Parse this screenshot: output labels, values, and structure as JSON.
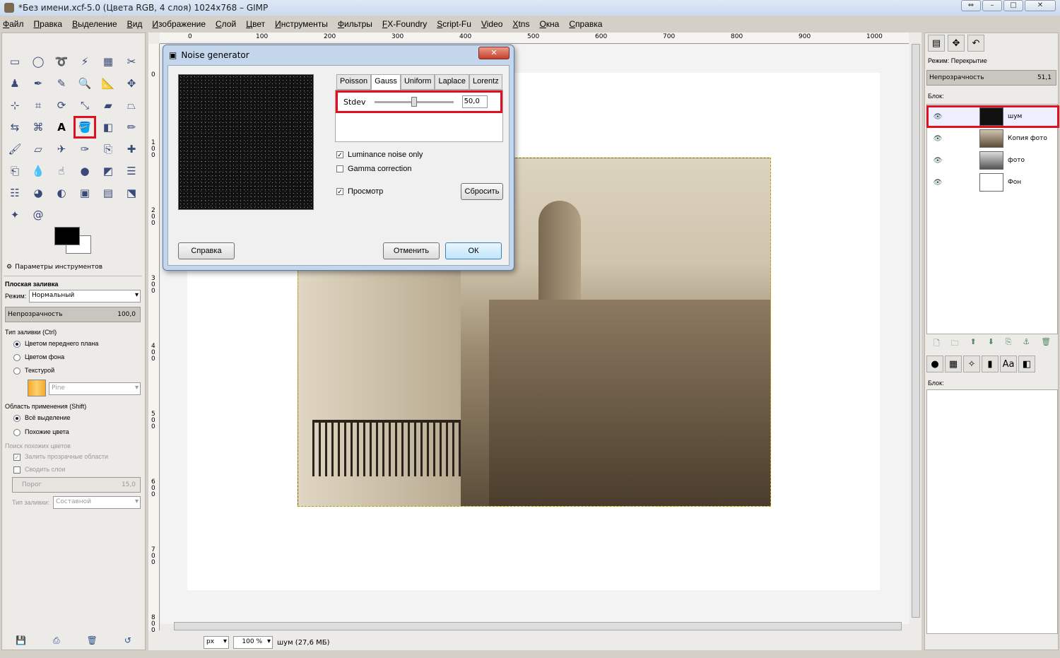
{
  "window": {
    "title": "*Без имени.xcf-5.0 (Цвета RGB, 4 слоя) 1024x768 – GIMP"
  },
  "menu": [
    "Файл",
    "Правка",
    "Выделение",
    "Вид",
    "Изображение",
    "Слой",
    "Цвет",
    "Инструменты",
    "Фильтры",
    "FX-Foundry",
    "Script-Fu",
    "Video",
    "Xtns",
    "Окна",
    "Справка"
  ],
  "toolbox": {
    "panel_title": "Параметры инструментов",
    "tool_name": "Плоская заливка",
    "mode_label": "Режим:",
    "mode_value": "Нормальный",
    "opacity_label": "Непрозрачность",
    "opacity_value": "100,0",
    "fill_type_label": "Тип заливки (Ctrl)",
    "fill_fg": "Цветом переднего плана",
    "fill_bg": "Цветом фона",
    "fill_pattern": "Текстурой",
    "pattern_name": "Pine",
    "area_label": "Область применения (Shift)",
    "area_all": "Всё выделение",
    "area_similar": "Похожие цвета",
    "search_label": "Поиск похожих цветов",
    "fill_transparent": "Залить прозрачные области",
    "merge_layers": "Сводить слои",
    "threshold_label": "Порог",
    "threshold_value": "15,0",
    "fill_by_label": "Тип заливки:",
    "fill_by_value": "Составной"
  },
  "ruler_h": [
    "0",
    "100",
    "200",
    "300",
    "400",
    "500",
    "600",
    "700",
    "800",
    "900",
    "1000"
  ],
  "ruler_v": [
    "0",
    "100",
    "200",
    "300",
    "400",
    "500",
    "600",
    "700",
    "800"
  ],
  "status": {
    "unit": "px",
    "zoom": "100 %",
    "layer_info": "шум (27,6 МБ)"
  },
  "dock": {
    "mode_label": "Режим: Перекрытие",
    "opacity_label": "Непрозрачность",
    "opacity_value": "51,1",
    "lock_label": "Блок:",
    "layers": [
      "шум",
      "Копия фото",
      "фото",
      "Фон"
    ],
    "brush_lock_label": "Блок:"
  },
  "dialog": {
    "title": "Noise generator",
    "tabs": [
      "Poisson",
      "Gauss",
      "Uniform",
      "Laplace",
      "Lorentz"
    ],
    "param_label": "Stdev",
    "param_value": "50,0",
    "param_fraction": 0.5,
    "luminance": "Luminance noise only",
    "gamma": "Gamma correction",
    "preview": "Просмотр",
    "reset": "Сбросить",
    "help": "Справка",
    "cancel": "Отменить",
    "ok": "ОК"
  }
}
